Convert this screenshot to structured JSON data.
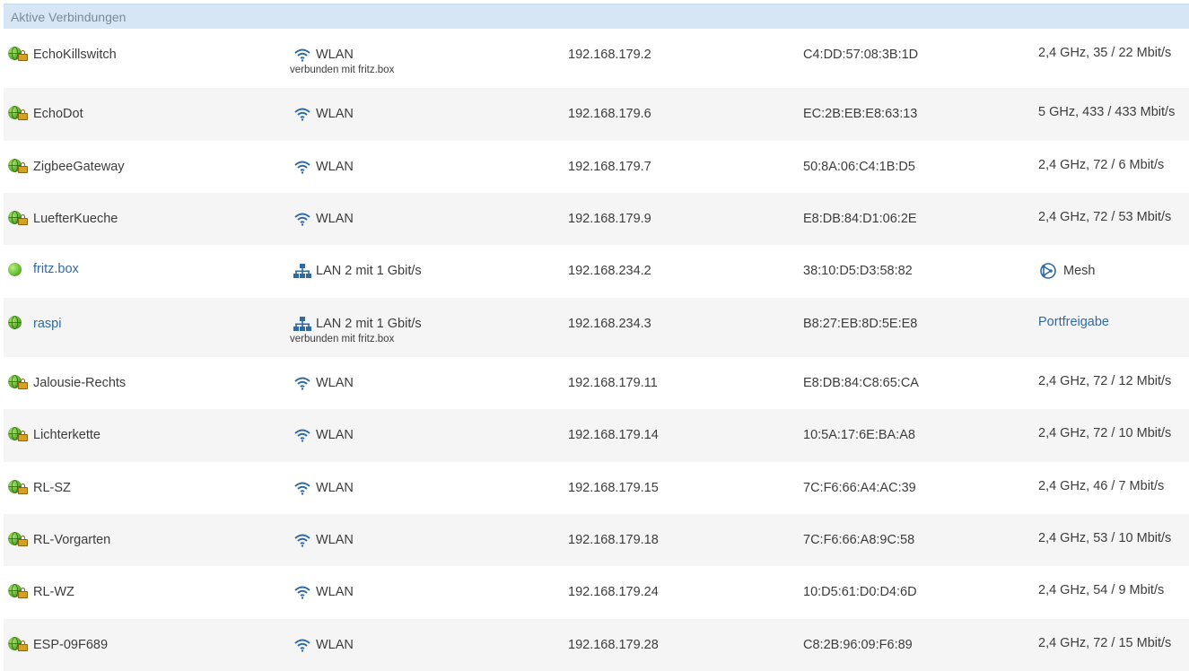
{
  "header": {
    "title": "Aktive Verbindungen"
  },
  "rows": [
    {
      "name": "EchoKillswitch",
      "icon": "globe-lock",
      "conn_icon": "wifi-icon",
      "conn": "WLAN",
      "sub": "verbunden mit fritz.box",
      "ip": "192.168.179.2",
      "mac": "C4:DD:57:08:3B:1D",
      "prop": "2,4 GHz, 35 / 22 Mbit/s"
    },
    {
      "name": "EchoDot",
      "icon": "globe-lock",
      "conn_icon": "wifi-icon",
      "conn": "WLAN",
      "ip": "192.168.179.6",
      "mac": "EC:2B:EB:E8:63:13",
      "prop": "5 GHz, 433 / 433 Mbit/s"
    },
    {
      "name": "ZigbeeGateway",
      "icon": "globe-lock",
      "conn_icon": "wifi-icon",
      "conn": "WLAN",
      "ip": "192.168.179.7",
      "mac": "50:8A:06:C4:1B:D5",
      "prop": "2,4 GHz, 72 / 6 Mbit/s"
    },
    {
      "name": "LuefterKueche",
      "icon": "globe-lock",
      "conn_icon": "wifi-icon",
      "conn": "WLAN",
      "ip": "192.168.179.9",
      "mac": "E8:DB:84:D1:06:2E",
      "prop": "2,4 GHz, 72 / 53 Mbit/s"
    },
    {
      "name": "fritz.box",
      "icon": "green-dot",
      "link": true,
      "conn_icon": "lan-icon",
      "conn": "LAN 2 mit 1 Gbit/s",
      "ip": "192.168.234.2",
      "mac": "38:10:D5:D3:58:82",
      "prop": "Mesh",
      "prop_icon": "mesh-icon"
    },
    {
      "name": "raspi",
      "icon": "globe",
      "link": true,
      "conn_icon": "lan-icon",
      "conn": "LAN 2 mit 1 Gbit/s",
      "sub": "verbunden mit fritz.box",
      "ip": "192.168.234.3",
      "mac": "B8:27:EB:8D:5E:E8",
      "prop": "Portfreigabe",
      "prop_link": true
    },
    {
      "name": "Jalousie-Rechts",
      "icon": "globe-lock",
      "conn_icon": "wifi-icon",
      "conn": "WLAN",
      "ip": "192.168.179.11",
      "mac": "E8:DB:84:C8:65:CA",
      "prop": "2,4 GHz, 72 / 12 Mbit/s"
    },
    {
      "name": "Lichterkette",
      "icon": "globe-lock",
      "conn_icon": "wifi-icon",
      "conn": "WLAN",
      "ip": "192.168.179.14",
      "mac": "10:5A:17:6E:BA:A8",
      "prop": "2,4 GHz, 72 / 10 Mbit/s"
    },
    {
      "name": "RL-SZ",
      "icon": "globe-lock",
      "conn_icon": "wifi-icon",
      "conn": "WLAN",
      "ip": "192.168.179.15",
      "mac": "7C:F6:66:A4:AC:39",
      "prop": "2,4 GHz, 46 / 7 Mbit/s"
    },
    {
      "name": "RL-Vorgarten",
      "icon": "globe-lock",
      "conn_icon": "wifi-icon",
      "conn": "WLAN",
      "ip": "192.168.179.18",
      "mac": "7C:F6:66:A8:9C:58",
      "prop": "2,4 GHz, 53 / 10 Mbit/s"
    },
    {
      "name": "RL-WZ",
      "icon": "globe-lock",
      "conn_icon": "wifi-icon",
      "conn": "WLAN",
      "ip": "192.168.179.24",
      "mac": "10:D5:61:D0:D4:6D",
      "prop": "2,4 GHz, 54 / 9 Mbit/s"
    },
    {
      "name": "ESP-09F689",
      "icon": "globe-lock",
      "conn_icon": "wifi-icon",
      "conn": "WLAN",
      "ip": "192.168.179.28",
      "mac": "C8:2B:96:09:F6:89",
      "prop": "2,4 GHz, 72 / 15 Mbit/s"
    }
  ],
  "colors": {
    "header_bg": "#d7e6f5",
    "link": "#2f6aa3",
    "row_alt": "#f5f5f5",
    "icon_blue": "#2f6aa3"
  }
}
